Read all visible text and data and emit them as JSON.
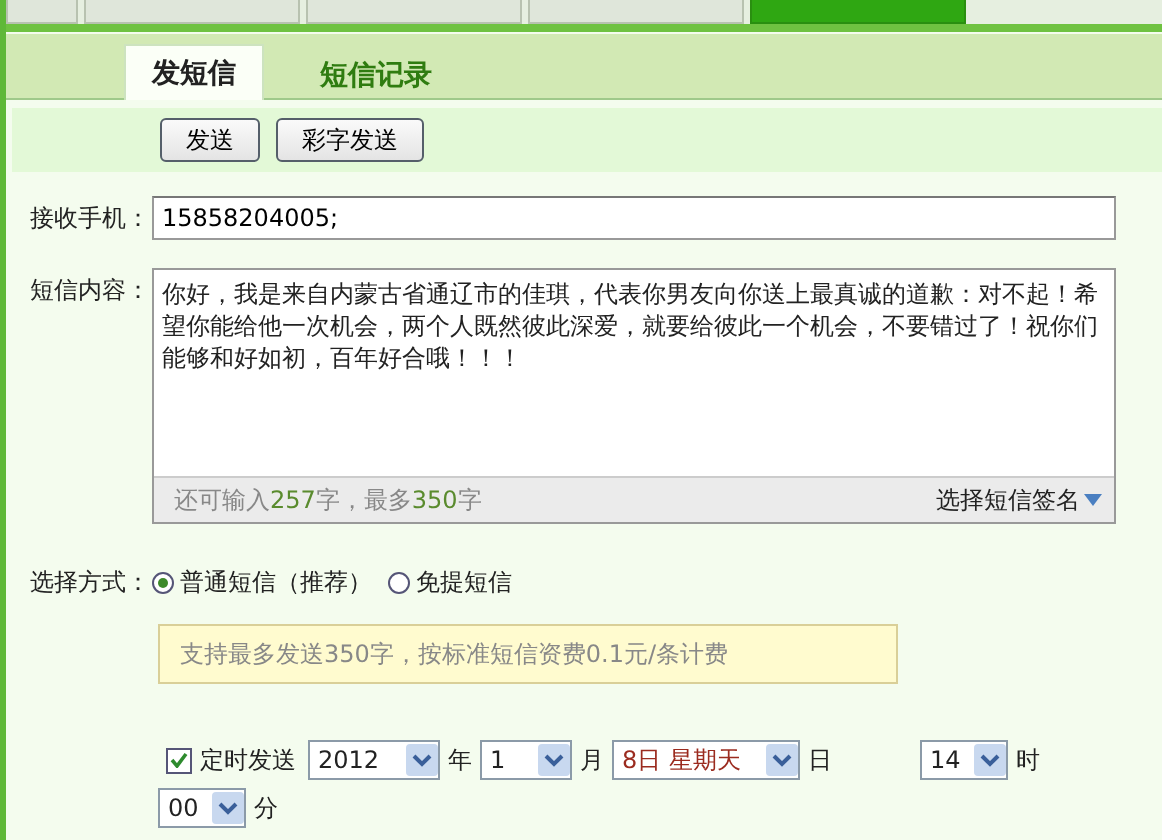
{
  "browser_tabs": [
    {
      "selected": false
    },
    {
      "selected": false
    },
    {
      "selected": false
    },
    {
      "selected": false
    },
    {
      "selected": true
    }
  ],
  "tabs": [
    {
      "label": "发短信",
      "selected": true
    },
    {
      "label": "短信记录",
      "selected": false
    }
  ],
  "toolbar": {
    "buttons": [
      "发送",
      "彩字发送"
    ]
  },
  "recipient": {
    "label": "接收手机：",
    "value": "15858204005;"
  },
  "message": {
    "label": "短信内容：",
    "value": "你好，我是来自内蒙古省通辽市的佳琪，代表你男友向你送上最真诚的道歉：对不起！希望你能给他一次机会，两个人既然彼此深爱，就要给彼此一个机会，不要错过了！祝你们能够和好如初，百年好合哦！！！",
    "counter": "还可输入**257**字，最多**350**字",
    "signature": "选择短信签名"
  },
  "send_mode": {
    "label": "选择方式：",
    "options": [
      {
        "label": "普通短信（推荐）",
        "selected": true
      },
      {
        "label": "免提短信",
        "selected": false
      }
    ],
    "hint": "支持最多发送350字，按标准短信资费0.1元/条计费"
  },
  "schedule": {
    "checked": true,
    "label": "定时发送",
    "fields": [
      {
        "value": "2012",
        "unit": "年",
        "emphasis": false
      },
      {
        "value": "1",
        "unit": "月",
        "emphasis": false
      },
      {
        "value": "8日 星期天",
        "unit": "日",
        "emphasis": true
      },
      {
        "value": "14",
        "unit": "时",
        "emphasis": false
      },
      {
        "value": "00",
        "unit": "分",
        "emphasis": false
      }
    ]
  }
}
